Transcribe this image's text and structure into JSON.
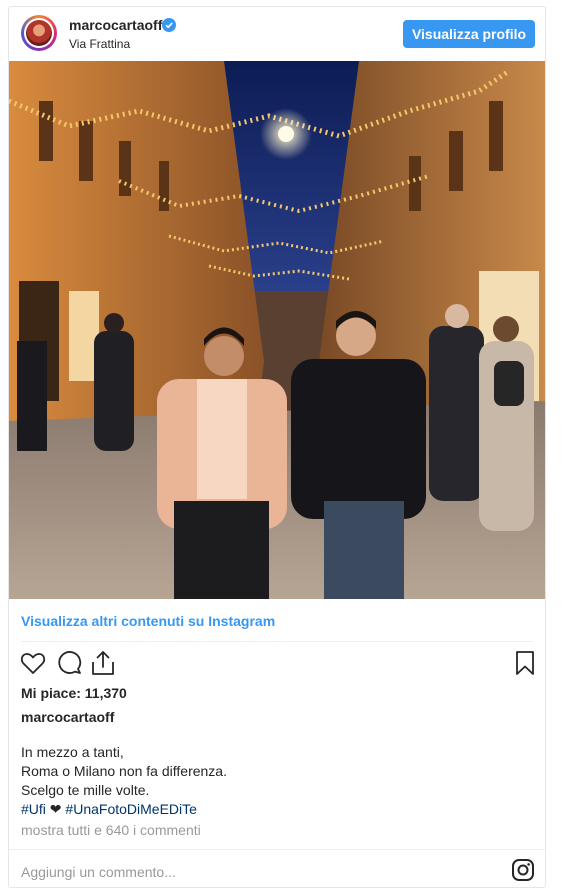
{
  "header": {
    "username": "marcocartaoff",
    "location": "Via Frattina",
    "view_profile_label": "Visualizza profilo"
  },
  "links": {
    "more_content": "Visualizza altri contenuti su Instagram",
    "all_comments": "mostra tutti e 640 i commenti"
  },
  "actions": {
    "icons": [
      "heart-icon",
      "comment-icon",
      "share-icon",
      "bookmark-icon"
    ]
  },
  "likes": {
    "text": "Mi piace: 11,370"
  },
  "caption": {
    "owner": "marcocartaoff",
    "lines": [
      "In mezzo a tanti,",
      "Roma o Milano non fa differenza.",
      "Scelgo te mille volte."
    ],
    "hashtag_1": "#Ufi",
    "heart": "❤",
    "hashtag_2": "#UnaFotoDiMeEDiTe"
  },
  "comment_box": {
    "placeholder": "Aggiungi un commento..."
  },
  "colors": {
    "accent": "#3897f0",
    "hashtag": "#003569",
    "muted": "#999999"
  }
}
